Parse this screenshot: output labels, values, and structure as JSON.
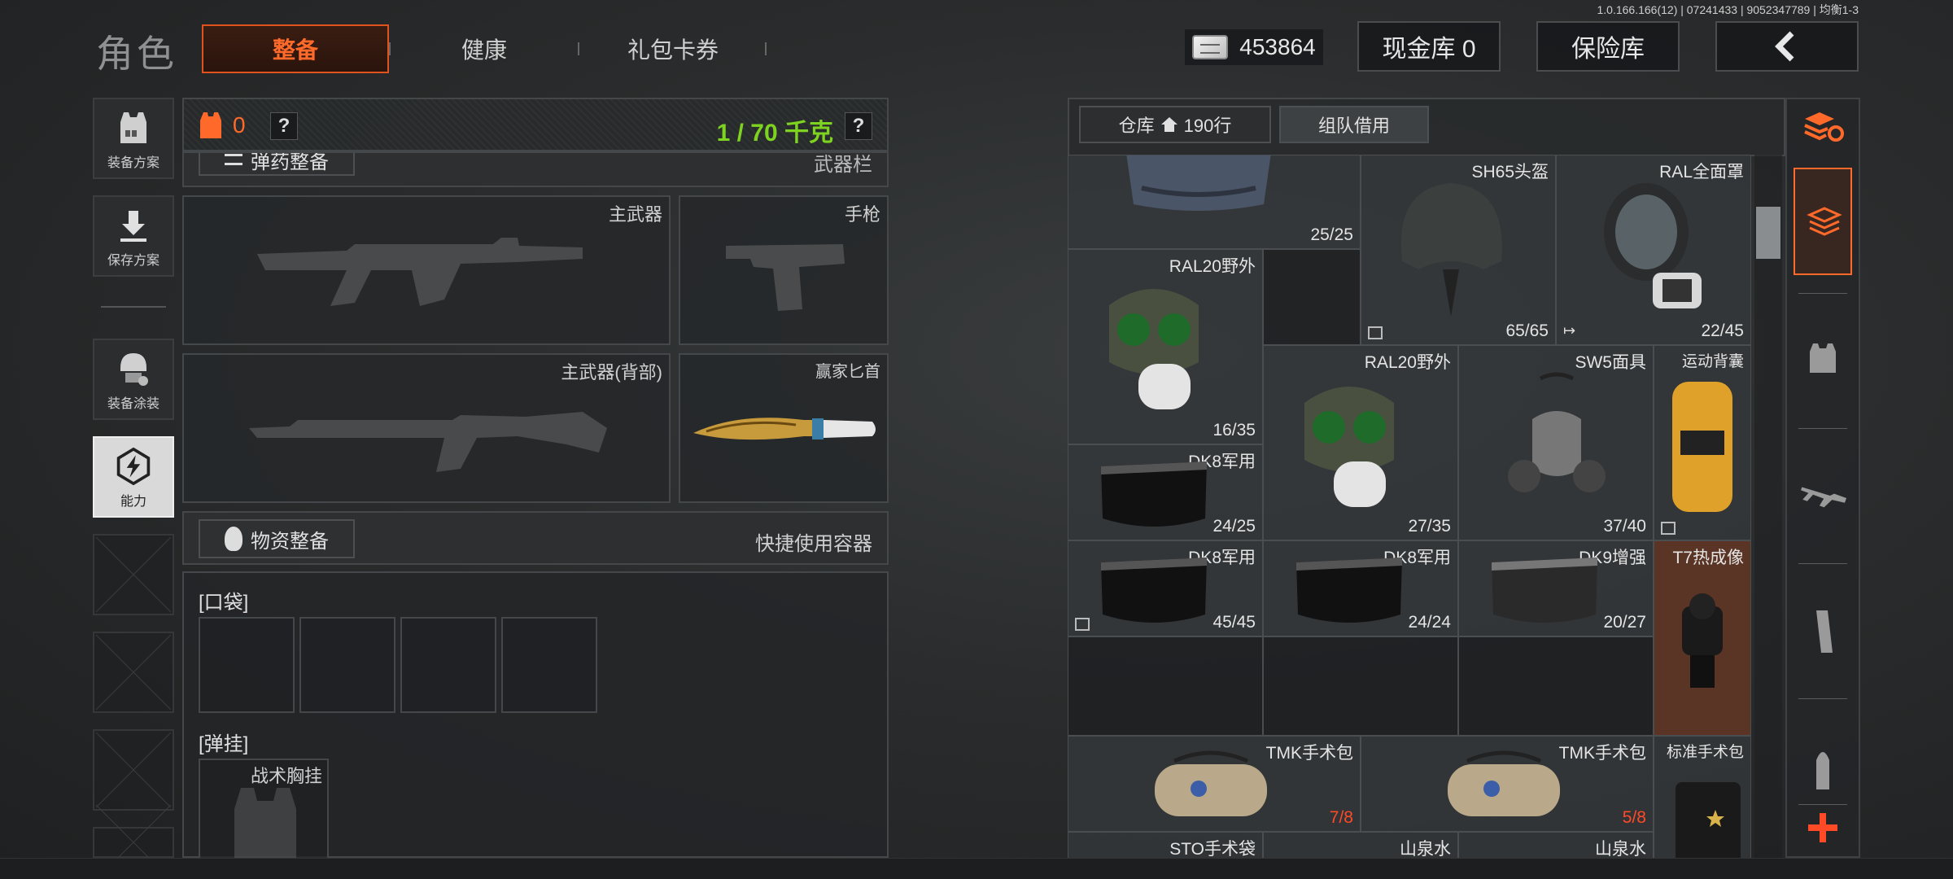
{
  "version": "1.0.166.166(12) | 07241433 | 9052347789 | 均衡1-3",
  "header": {
    "title": "角色",
    "tabs": [
      {
        "label": "整备",
        "active": true
      },
      {
        "label": "健康",
        "active": false
      },
      {
        "label": "礼包卡券",
        "active": false
      }
    ],
    "money": "453864",
    "cash_vault": "现金库 0",
    "safe": "保险库",
    "back_icon": "chevron-left-icon"
  },
  "sidebar": {
    "items": [
      {
        "label": "装备方案",
        "icon": "armor-vest-icon"
      },
      {
        "label": "保存方案",
        "icon": "download-icon"
      },
      {
        "label": "装备涂装",
        "icon": "helmet-paint-icon"
      },
      {
        "label": "能力",
        "icon": "ability-bolt-icon",
        "active": true
      }
    ]
  },
  "loadout": {
    "armor_count": "0",
    "weight": "1 / 70 千克",
    "weight_color": "#7ed321",
    "armor_color": "#ff6a2b",
    "ammo_section": "弹药整备",
    "weapon_rack": "武器栏",
    "slots": {
      "primary": "主武器",
      "pistol": "手枪",
      "primary_back": "主武器(背部)",
      "knife": "赢家匕首"
    },
    "supplies_btn": "物资整备",
    "quick_container": "快捷使用容器",
    "pocket_label": "口袋",
    "rig_label": "弹挂",
    "rig_item": "战术胸挂"
  },
  "warehouse": {
    "tab_storage": "仓库",
    "rows": "190行",
    "tab_team": "组队借用",
    "items": [
      {
        "name": "",
        "count": "25/25"
      },
      {
        "name": "SH65头盔",
        "count": "65/65"
      },
      {
        "name": "RAL全面罩",
        "count": "22/45"
      },
      {
        "name": "RAL20野外",
        "count": "16/35"
      },
      {
        "name": "RAL20野外",
        "count": "27/35"
      },
      {
        "name": "SW5面具",
        "count": "37/40"
      },
      {
        "name": "运动背囊",
        "count": ""
      },
      {
        "name": "DK8军用",
        "count": "24/25"
      },
      {
        "name": "DK8军用",
        "count": "45/45"
      },
      {
        "name": "DK8军用",
        "count": "24/24"
      },
      {
        "name": "DK9增强",
        "count": "20/27"
      },
      {
        "name": "T7热成像",
        "count": ""
      },
      {
        "name": "TMK手术包",
        "count": "7/8"
      },
      {
        "name": "TMK手术包",
        "count": "5/8"
      },
      {
        "name": "标准手术包",
        "count": ""
      },
      {
        "name": "STO手术袋",
        "count": ""
      },
      {
        "name": "山泉水",
        "count": ""
      },
      {
        "name": "山泉水",
        "count": ""
      }
    ]
  },
  "right_column": {
    "icons": [
      "layers-refresh-icon",
      "layers-active-icon",
      "vest-icon",
      "rifle-icon",
      "magazine-icon",
      "bullet-icon",
      "plus-icon"
    ]
  },
  "colors": {
    "accent": "#ff6a2b",
    "count_red": "#ff4a28"
  }
}
